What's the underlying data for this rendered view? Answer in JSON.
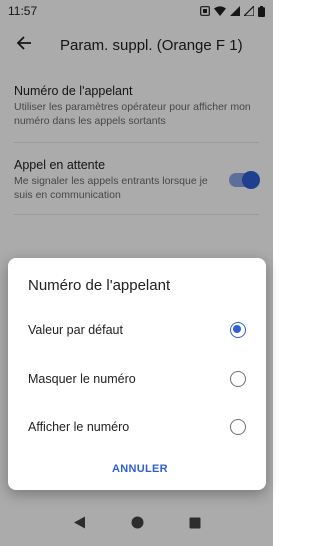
{
  "status_bar": {
    "time": "11:57",
    "icons": [
      "screenshot-icon",
      "wifi-icon",
      "signal-icon",
      "signal-icon",
      "battery-icon"
    ]
  },
  "app_bar": {
    "title": "Param. suppl. (Orange F 1)",
    "back_icon": "back-arrow-icon"
  },
  "settings": [
    {
      "title": "Numéro de l'appelant",
      "subtitle": "Utiliser les paramètres opérateur pour afficher mon numéro dans les appels sortants"
    },
    {
      "title": "Appel en attente",
      "subtitle": "Me signaler les appels entrants lorsque je suis en communication",
      "toggle_on": true
    }
  ],
  "dialog": {
    "title": "Numéro de l'appelant",
    "options": [
      {
        "label": "Valeur par défaut",
        "selected": true
      },
      {
        "label": "Masquer le numéro",
        "selected": false
      },
      {
        "label": "Afficher le numéro",
        "selected": false
      }
    ],
    "cancel_label": "ANNULER"
  },
  "colors": {
    "accent": "#2f5fd6",
    "scrim": "rgba(0,0,0,0.33)"
  },
  "nav_bar": {
    "icons": [
      "back-triangle-icon",
      "home-circle-icon",
      "recents-square-icon"
    ]
  }
}
